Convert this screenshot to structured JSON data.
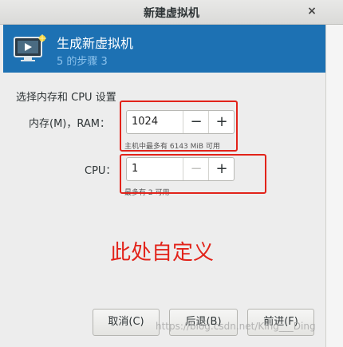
{
  "window": {
    "title": "新建虚拟机",
    "close_glyph": "×"
  },
  "header": {
    "icon": "monitor-icon",
    "title": "生成新虚拟机",
    "step": "5 的步骤 3"
  },
  "section": {
    "label": "选择内存和 CPU 设置"
  },
  "memory": {
    "label": "内存(M)，RAM：",
    "value": "1024",
    "decrement": "−",
    "increment": "+",
    "hint": "主机中最多有 6143 MiB 可用"
  },
  "cpu": {
    "label": "CPU：",
    "value": "1",
    "decrement": "−",
    "increment": "+",
    "hint": "最多有 2 可用"
  },
  "annotation": {
    "text": "此处自定义",
    "color": "#e2231a"
  },
  "buttons": {
    "cancel": "取消(C)",
    "back": "后退(B)",
    "forward": "前进(F)"
  },
  "watermark": "https://blog.csdn.net/King___Ding",
  "colors": {
    "header_bg": "#1d71b3",
    "step_text": "#8cc2ec",
    "window_bg": "#ededed"
  }
}
